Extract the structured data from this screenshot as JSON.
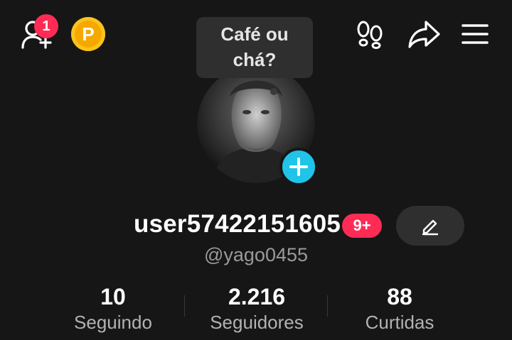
{
  "header": {
    "notification_count": "1",
    "coin_label": "P"
  },
  "avatar": {
    "note_bubble": "Café ou chá?"
  },
  "profile": {
    "username": "user57422151605",
    "badge": "9+",
    "handle": "@yago0455"
  },
  "stats": [
    {
      "value": "10",
      "label": "Seguindo"
    },
    {
      "value": "2.216",
      "label": "Seguidores"
    },
    {
      "value": "88",
      "label": "Curtidas"
    }
  ],
  "colors": {
    "background": "#161616",
    "badge_red": "#fe2c55",
    "add_blue": "#20c4e8",
    "coin_gold": "#f5a900"
  }
}
